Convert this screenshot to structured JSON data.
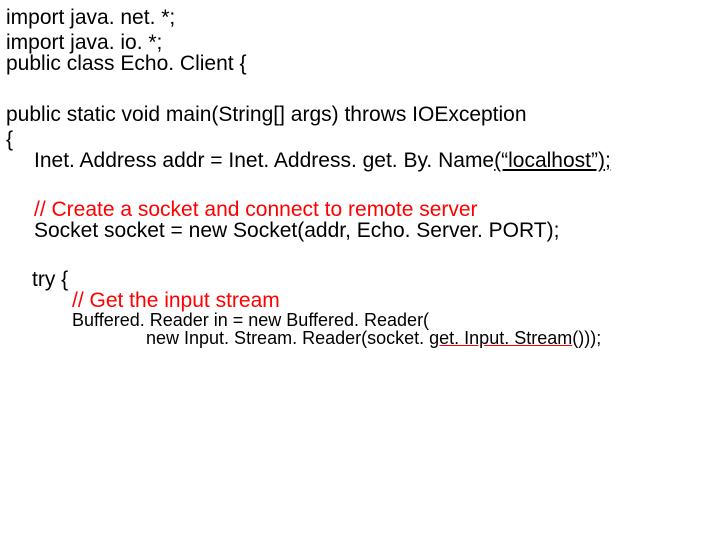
{
  "lines": {
    "l1": "import java. net. *;",
    "l2": "import java. io. *;",
    "l3": "public class Echo. Client {",
    "l5": "public static void main(String[] args) throws IOException",
    "l6": "{",
    "l7a": "Inet. Address addr = Inet. Address. get. By. Name",
    "l7b": "(“localhost”);",
    "l8": "// Create a socket and connect to remote server",
    "l9": "Socket socket = new Socket(addr, Echo. Server. PORT);",
    "l10": "try {",
    "l11": "// Get the input stream",
    "l12": "Buffered. Reader in = new Buffered. Reader(",
    "l13a": "new Input. Stream. Reader(socket. ",
    "l13b": "get. Input. Stream",
    "l13c": "()));"
  }
}
